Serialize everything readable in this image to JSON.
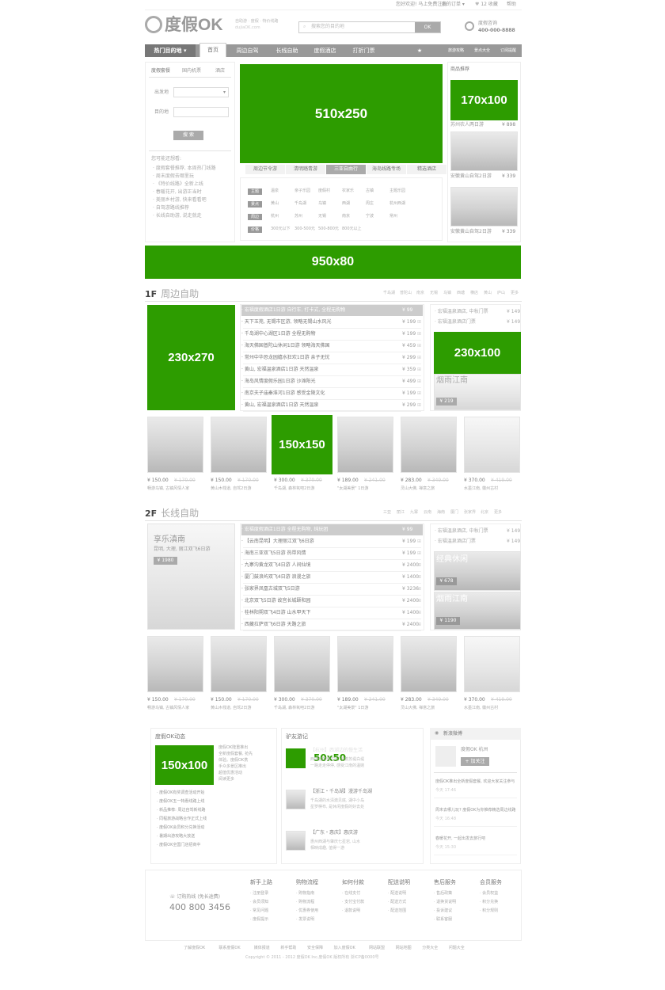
{
  "topbar": {
    "links": [
      "您好欢迎!  马上免费注册",
      "我的订单 ▾",
      "12 收藏",
      "帮助"
    ]
  },
  "header": {
    "logo_text": "度假OK",
    "slogan_line1": "自助游 · 度假 · 特价线路",
    "slogan_line2": "dujiaOK.com",
    "search_placeholder": "搜索您的目的地",
    "search_button": "OK",
    "hotline_label": "度假咨询",
    "hotline_number": "400-000-8888"
  },
  "nav": {
    "dropdown": "热门目的地 ▾",
    "items": [
      "首页",
      "周边自驾",
      "长线自助",
      "度假酒店",
      "打折门票"
    ],
    "right_links": [
      "旅游攻略",
      "景点大全",
      "订阅提醒"
    ]
  },
  "search_panel": {
    "tabs": [
      "度假套餐",
      "国内机票",
      "酒店"
    ],
    "from_label": "出发地",
    "to_label": "目的地",
    "submit": "搜 索",
    "hot_title": "您可能还想看:",
    "hot_links": [
      "· 度假套餐推荐, 本周热门线路",
      "· 周末度假去哪里玩",
      "· 《特价线路》全新上线",
      "· 春暖花开, 出游正当时",
      "· 美丽乡村游, 快来看看吧",
      "· 自驾游路线推荐",
      "· 长线自助游, 说走就走"
    ]
  },
  "banner": {
    "size_label": "510x250",
    "tabs": [
      "周边节令游",
      "清明踏青游",
      "三亚自由行",
      "海岛线路专场",
      "精选酒店"
    ]
  },
  "hot_tags": {
    "rows": [
      {
        "tag": "主题",
        "items": [
          "温泉",
          "亲子乐园",
          "度假村",
          "农家乐",
          "古镇",
          "主题乐园"
        ]
      },
      {
        "tag": "景点",
        "items": [
          "黄山",
          "千岛湖",
          "乌镇",
          "西湖",
          "周庄",
          "杭州西湖"
        ]
      },
      {
        "tag": "周边",
        "items": [
          "杭州",
          "苏州",
          "无锡",
          "南京",
          "宁波",
          "常州"
        ]
      },
      {
        "tag": "价格",
        "items": [
          "300元以下",
          "300-500元",
          "500-800元",
          "800元以上"
        ]
      }
    ]
  },
  "right_products": {
    "title": "商品推荐",
    "size_label": "170x100",
    "items": [
      {
        "name": "苏州农人两日游",
        "price": "¥ 898"
      },
      {
        "name": "安徽黄山自驾2日游",
        "price": "¥ 339"
      },
      {
        "name": "安徽黄山自驾2日游",
        "price": "¥ 339"
      }
    ]
  },
  "ad_banner": {
    "size_label": "950x80"
  },
  "floor1": {
    "num": "1F",
    "title": "周边自助",
    "links": [
      "千岛湖",
      "普陀山",
      "南京",
      "无锡",
      "乌镇",
      "西塘",
      "横店",
      "黄山",
      "庐山",
      "更多"
    ],
    "main_img_label": "230x270",
    "side_img_label": "230x100",
    "side_caption": "烟雨江南",
    "side_price": "¥ 219",
    "list": [
      {
        "title": "· 宏福度假酒店1日游  自行车, 打卡式, 全程无购物",
        "price": "¥ 99"
      },
      {
        "title": "· 天下玉苑, 无锡市区游, 领略无锡山水风光",
        "price": "¥ 199"
      },
      {
        "title": "· 千岛湖中心湖区1日游  全程无购物",
        "price": "¥ 199"
      },
      {
        "title": "· 海天佛国普陀山休闲1日游  领略海天佛国",
        "price": "¥ 459"
      },
      {
        "title": "· 常州中华恐龙园嬉水狂欢1日游  亲子无忧",
        "price": "¥ 299"
      },
      {
        "title": "· 黄山, 宏福温泉酒店1日游  天然温泉",
        "price": "¥ 359"
      },
      {
        "title": "· 海岛风情度假乐园1日游  沙滩阳光",
        "price": "¥ 499"
      },
      {
        "title": "· 南京夫子庙秦淮河1日游  感受金陵文化",
        "price": "¥ 199"
      },
      {
        "title": "· 黄山, 宏福温泉酒店1日游  天然温泉",
        "price": "¥ 299"
      }
    ],
    "side_list": [
      {
        "title": "· 宏福温泉酒店, 中秋门票",
        "price": "¥ 149"
      },
      {
        "title": "· 宏福温泉酒店门票",
        "price": "¥ 149"
      }
    ],
    "products": [
      {
        "price": "¥ 150.00",
        "old": "¥ 170.00",
        "name": "畅游乌镇, 古镇风情人家"
      },
      {
        "price": "¥ 150.00",
        "old": "¥ 170.00",
        "name": "黄山木栈道, 自驾2日游"
      },
      {
        "price": "¥ 300.00",
        "old": "¥ 370.00",
        "name": "千岛湖, 森林氧吧2日游"
      },
      {
        "price": "¥ 189.00",
        "old": "¥ 241.00",
        "name": "\"太湖美景\" 1日游"
      },
      {
        "price": "¥ 283.00",
        "old": "¥ 349.00",
        "name": "灵山大佛, 禅意之旅"
      },
      {
        "price": "¥ 370.00",
        "old": "¥ 419.00",
        "name": "水墨江南, 徽州古村"
      }
    ],
    "product_img_label": "150x150"
  },
  "floor2": {
    "num": "2F",
    "title": "长线自助",
    "links": [
      "三亚",
      "丽江",
      "九寨",
      "云南",
      "海南",
      "厦门",
      "张家界",
      "北京",
      "更多"
    ],
    "main_caption": "享乐滇南",
    "main_sub": "昆明, 大理, 丽江双飞6日游",
    "main_price": "¥ 1980",
    "side1_caption": "经典休闲",
    "side1_price": "¥ 678",
    "side2_caption": "烟雨江南",
    "side2_price": "¥ 1190",
    "list": [
      {
        "title": "· 宏福度假酒店1日游  全程无购物, 纯玩团",
        "price": "¥ 99"
      },
      {
        "title": "· 【云南昆明】大理丽江双飞6日游",
        "price": "¥ 199"
      },
      {
        "title": "· 海南三亚双飞5日游  热带风情",
        "price": "¥ 199"
      },
      {
        "title": "· 九寨沟黄龙双飞4日游  人间仙境",
        "price": "¥ 2400"
      },
      {
        "title": "· 厦门鼓浪屿双飞4日游  浪漫之旅",
        "price": "¥ 1400"
      },
      {
        "title": "· 张家界凤凰古城双飞5日游",
        "price": "¥ 3236"
      },
      {
        "title": "· 北京双飞5日游  故宫长城颐和园",
        "price": "¥ 2400"
      },
      {
        "title": "· 桂林阳朔双飞4日游  山水甲天下",
        "price": "¥ 1400"
      },
      {
        "title": "· 西藏拉萨双飞6日游  天路之旅",
        "price": "¥ 2400"
      }
    ],
    "side_list": [
      {
        "title": "· 宏福温泉酒店, 中秋门票",
        "price": "¥ 149"
      },
      {
        "title": "· 宏福温泉酒店门票",
        "price": "¥ 149"
      }
    ],
    "products": [
      {
        "price": "¥ 150.00",
        "old": "¥ 170.00",
        "name": "畅游乌镇, 古镇风情人家"
      },
      {
        "price": "¥ 150.00",
        "old": "¥ 170.00",
        "name": "黄山木栈道, 自驾2日游"
      },
      {
        "price": "¥ 300.00",
        "old": "¥ 370.00",
        "name": "千岛湖, 森林氧吧2日游"
      },
      {
        "price": "¥ 189.00",
        "old": "¥ 241.00",
        "name": "\"太湖美景\" 1日游"
      },
      {
        "price": "¥ 283.00",
        "old": "¥ 349.00",
        "name": "灵山大佛, 禅意之旅"
      },
      {
        "price": "¥ 370.00",
        "old": "¥ 419.00",
        "name": "水墨江南, 徽州古村"
      }
    ]
  },
  "news": {
    "title": "度假OK动态",
    "img_label": "150x100",
    "intro": [
      "度假OK隆重推出",
      "全新度假套餐, 抢先",
      "体验。度假OK携",
      "手众多景区推出",
      "超值优惠活动",
      "阅读更多"
    ],
    "items": [
      "· 度假OK有奖调查活动开始",
      "· 度假OK五一特惠线路上线",
      "· 新品推荐: 周边自驾新线路",
      "· 同程旅游战略合作正式上线",
      "· 度假OK会员积分兑换活动",
      "· 暑期出游攻略大放送",
      "· 度假OK全国门店招商中"
    ]
  },
  "guide": {
    "title": "驴友游记",
    "img_label": "50x50",
    "items": [
      {
        "head": "【杭州】西湖边的慢生活",
        "body": [
          "西湖边的慢生活, 沿着苏堤白堤",
          "一路走走停停, 感受江南的温婉"
        ]
      },
      {
        "head": "【浙江・千岛湖】漫游千岛湖",
        "body": [
          "千岛湖的水清澈见底, 湖中小岛",
          "星罗棋布, 是休闲度假的好去处"
        ]
      },
      {
        "head": "【广东・惠庆】惠庆游",
        "body": [
          "惠州西湖与肇庆七星岩, 山水",
          "相映成趣, 值得一游"
        ]
      }
    ]
  },
  "weibo": {
    "title": "新浪微博",
    "name": "度假OK 杭州",
    "follow": "+ 加关注",
    "posts": [
      {
        "text": "度假OK推出全新度假套餐, 欢迎大家关注参与",
        "time": "今天 17:46"
      },
      {
        "text": "周末去哪儿玩? 度假OK为你推荐精选周边线路",
        "time": "今天 16:48"
      },
      {
        "text": "春暖花开, 一起出发去旅行吧",
        "time": "今天 15:30"
      }
    ]
  },
  "footer_help": {
    "phone_label": "订购热线 (免长途费)",
    "phone": "400 800 3456",
    "cols": [
      {
        "title": "新手上路",
        "items": [
          "· 注册登录",
          "· 会员须知",
          "· 常见问题",
          "· 度假提示"
        ]
      },
      {
        "title": "购物流程",
        "items": [
          "· 购物指南",
          "· 购物流程",
          "· 优惠券使用",
          "· 发票说明"
        ]
      },
      {
        "title": "如何付款",
        "items": [
          "· 在线支付",
          "· 支付宝付款",
          "· 退款说明"
        ]
      },
      {
        "title": "配送说明",
        "items": [
          "· 配送说明",
          "· 配送方式",
          "· 配送范围"
        ]
      },
      {
        "title": "售后服务",
        "items": [
          "· 售后政策",
          "· 退换货说明",
          "· 投诉建议",
          "· 联系客服"
        ]
      },
      {
        "title": "会员服务",
        "items": [
          "· 会员权益",
          "· 积分兑换",
          "· 积分规则"
        ]
      }
    ]
  },
  "footer": {
    "links": [
      "了解度假OK",
      "联系度假OK",
      "媒体报道",
      "新手帮助",
      "安全保障",
      "加入度假OK",
      "网站联盟",
      "网站地图",
      "分类大全",
      "问题大全"
    ],
    "copyright": "Copyright © 2011 - 2012 度假OK Inc.度假OK 版权所有  浙ICP备0000号"
  },
  "colors": {
    "placeholder": "#2d9c00",
    "nav_bg": "#999999"
  }
}
